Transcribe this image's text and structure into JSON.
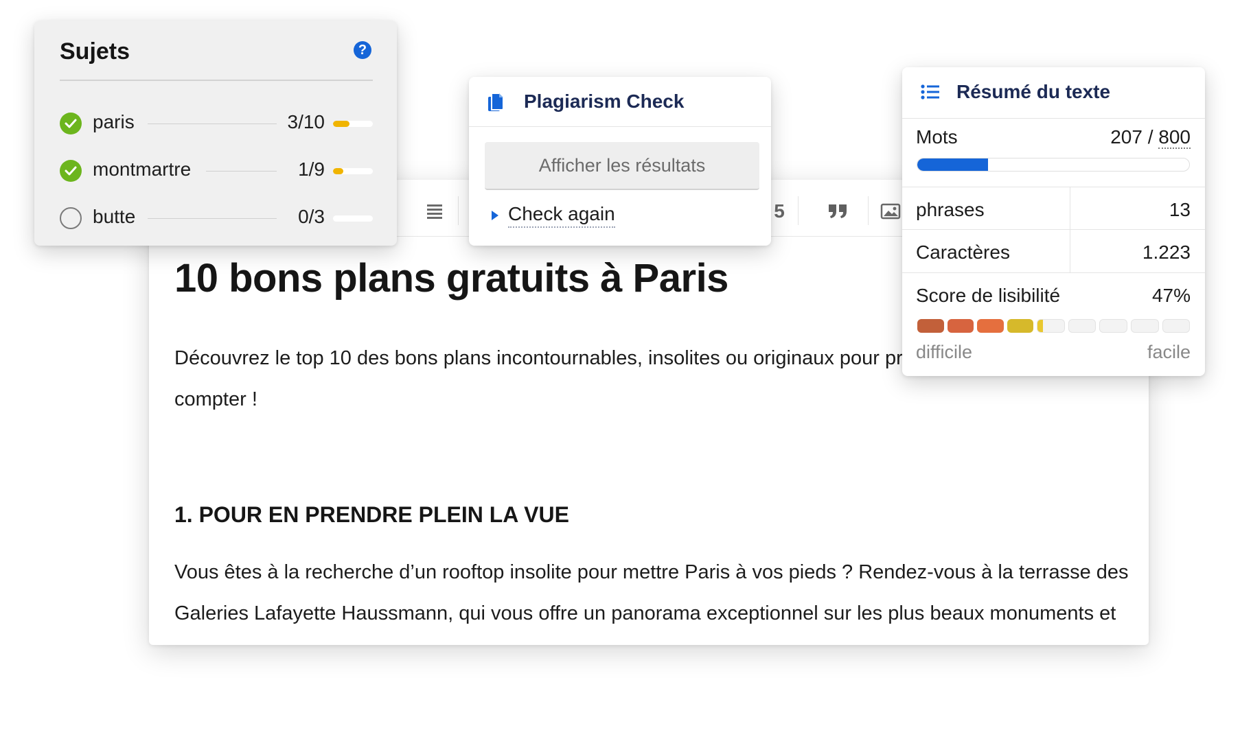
{
  "editor": {
    "toolbar": {
      "partial_label": "5",
      "icons": [
        "align-justify-icon",
        "align-center-icon",
        "quote-icon",
        "image-icon"
      ]
    },
    "heading": "10 bons plans gratuits à Paris",
    "intro": "Découvrez le top 10 des bons plans incontournables, insolites ou originaux pour profiter de Paris sans compter !",
    "section_heading": "1. POUR EN PRENDRE PLEIN LA VUE",
    "section_body": "Vous êtes à la recherche d’un rooftop insolite pour mettre Paris à vos pieds ? Rendez-vous à la terrasse des Galeries Lafayette Haussmann, qui vous offre un panorama exceptionnel sur les plus beaux monuments et lieux de la capitale : Opéra-Garnier, tour Eiffel, Montmartre… Pour atteindre le septième ciel,"
  },
  "sujets": {
    "title": "Sujets",
    "help_symbol": "?",
    "topics": [
      {
        "name": "paris",
        "count": "3/10",
        "progress": 0.42,
        "checked": true
      },
      {
        "name": "montmartre",
        "count": "1/9",
        "progress": 0.25,
        "checked": true
      },
      {
        "name": "butte",
        "count": "0/3",
        "progress": 0.0,
        "checked": false
      }
    ]
  },
  "plagiarism": {
    "title": "Plagiarism Check",
    "results_button": "Afficher les résultats",
    "check_again": "Check again"
  },
  "resume": {
    "title": "Résumé du texte",
    "words_label": "Mots",
    "words_count": "207",
    "words_separator": " / ",
    "words_max": "800",
    "words_progress": 0.26,
    "sentences_label": "phrases",
    "sentences_value": "13",
    "chars_label": "Caractères",
    "chars_value": "1.223",
    "readability_label": "Score de lisibilité",
    "readability_value": "47%",
    "readability_segments": 9,
    "readability_colors": [
      "#c2603a",
      "#d7643f",
      "#e56f3e",
      "#d6b92b",
      "#e9c82f"
    ],
    "readability_last_partial": 0.2,
    "scale_low": "difficile",
    "scale_high": "facile"
  },
  "colors": {
    "accent": "#1565d8",
    "check_green": "#6cb51d",
    "progress_yellow": "#f0b400",
    "panel_title": "#1c2a55"
  }
}
